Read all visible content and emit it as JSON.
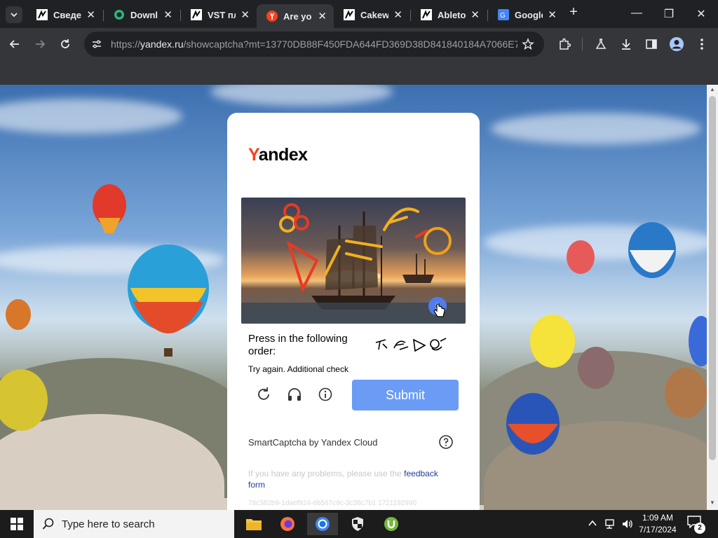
{
  "tabs": [
    {
      "title": "Сведе",
      "icon": "hackernoon-icon"
    },
    {
      "title": "Downl",
      "icon": "download-site-icon"
    },
    {
      "title": "VST пл",
      "icon": "hackernoon-icon"
    },
    {
      "title": "Are yo",
      "icon": "yandex-icon",
      "active": true
    },
    {
      "title": "Cakew",
      "icon": "hackernoon-icon"
    },
    {
      "title": "Ableto",
      "icon": "hackernoon-icon"
    },
    {
      "title": "Google",
      "icon": "google-translate-icon"
    }
  ],
  "address_bar": {
    "scheme": "https://",
    "host": "yandex.ru",
    "path": "/showcaptcha?mt=13770DB88F450FDA644FD369D38D841840184A7066E7..."
  },
  "captcha": {
    "logo_first": "Y",
    "logo_rest": "andex",
    "instruction": "Press in the following order:",
    "status": "Try again. Additional check",
    "submit_label": "Submit",
    "brand": "SmartCaptcha by Yandex Cloud",
    "problems_text": "If you have any problems, please use the",
    "feedback_link": "feedback form",
    "token": "78c382b9-1daef924-6b567c9c-3c38c7b1 1721192990",
    "click_marker": "1"
  },
  "taskbar": {
    "search_placeholder": "Type here to search",
    "time": "1:09 AM",
    "date": "7/17/2024",
    "notification_count": "2"
  },
  "colors": {
    "yandex_red": "#fc3f1d",
    "submit_blue": "#6a9cf5",
    "browser_dark": "#202124",
    "browser_toolbar": "#35363a"
  }
}
